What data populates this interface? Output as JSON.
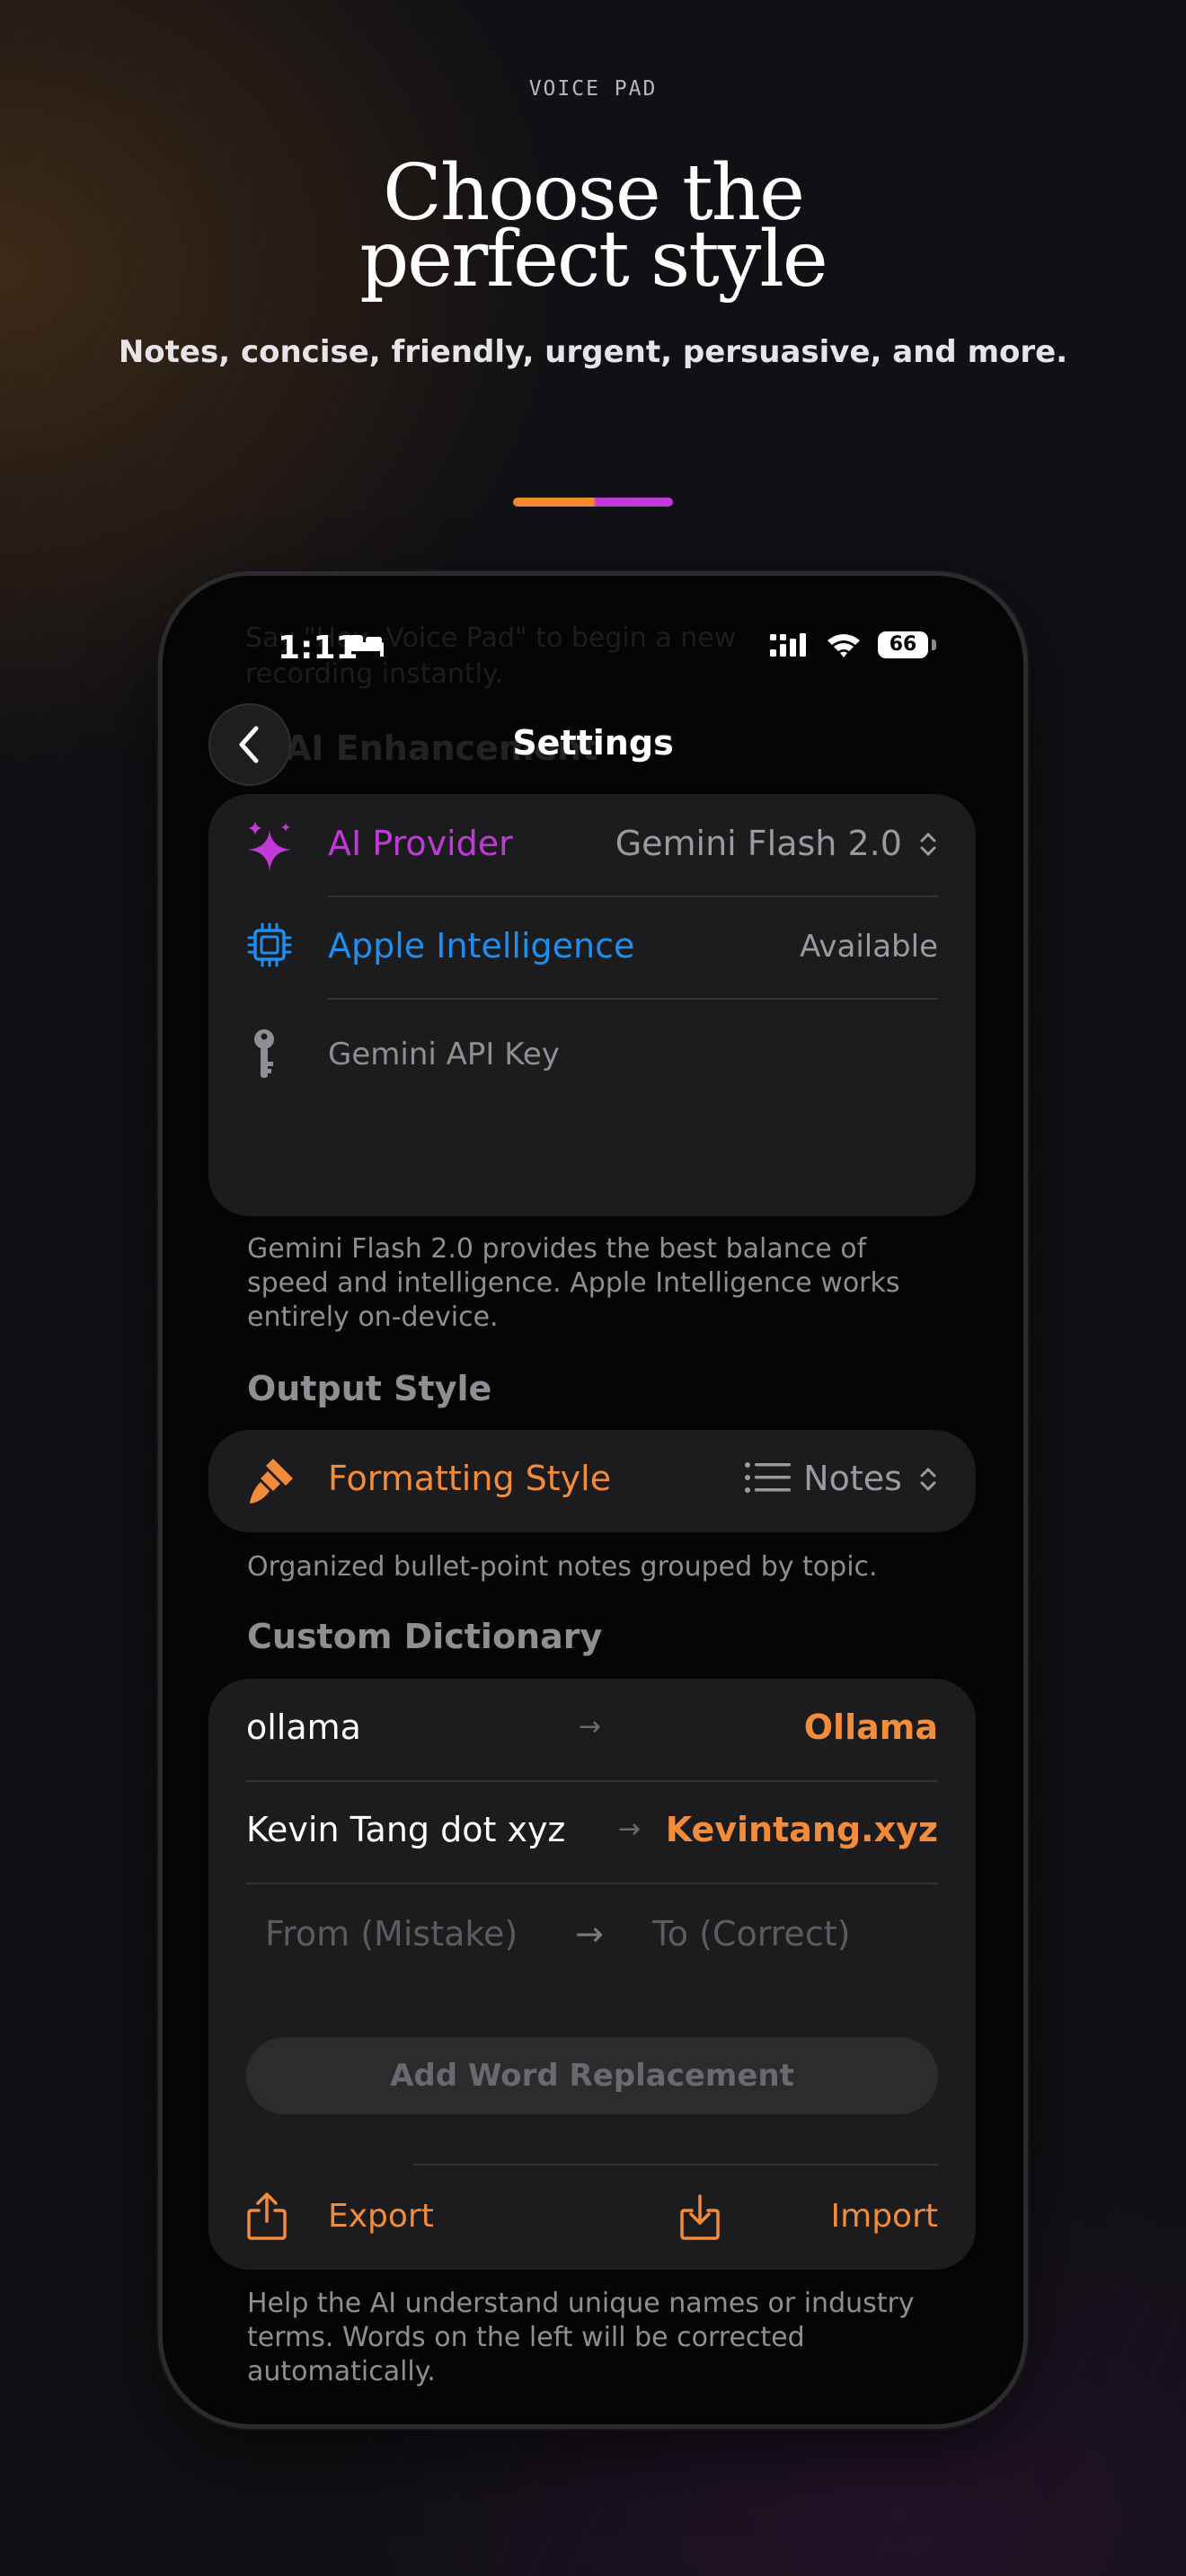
{
  "header": {
    "eyebrow": "VOICE PAD",
    "headline_line1": "Choose the",
    "headline_line2": "perfect style",
    "subhead": "Notes, concise, friendly, urgent, persuasive, and more."
  },
  "colors": {
    "accent_orange": "#f28c3a",
    "accent_purple": "#c13ad9",
    "accent_blue": "#1e8ef0",
    "card_bg": "#1c1c1e"
  },
  "status_bar": {
    "time": "1:11",
    "battery": "66",
    "icons": [
      "bed-icon",
      "signal-icon",
      "wifi-icon",
      "battery-icon"
    ]
  },
  "ghost_text": {
    "line1": "Say \"Hey, Voice Pad\" to begin a new",
    "line2": "recording instantly.",
    "section": "AI Enhancement"
  },
  "nav": {
    "title": "Settings",
    "back_icon": "chevron-left-icon"
  },
  "ai_section": {
    "rows": [
      {
        "icon": "sparkles-icon",
        "label": "AI Provider",
        "value": "Gemini Flash 2.0",
        "color": "#c13ad9"
      },
      {
        "icon": "cpu-icon",
        "label": "Apple Intelligence",
        "value": "Available",
        "color": "#1e8ef0"
      },
      {
        "icon": "key-icon",
        "label": "Gemini API Key",
        "value": ""
      }
    ],
    "footnote": "Gemini Flash 2.0 provides the best balance of speed and intelligence. Apple Intelligence works entirely on-device."
  },
  "output_style": {
    "section_title": "Output Style",
    "label": "Formatting Style",
    "value": "Notes",
    "icon": "paintbrush-icon",
    "footnote": "Organized bullet-point notes grouped by topic."
  },
  "dictionary": {
    "section_title": "Custom Dictionary",
    "entries": [
      {
        "from": "ollama",
        "to": "Ollama"
      },
      {
        "from": "Kevin Tang dot xyz",
        "to": "Kevintang.xyz"
      }
    ],
    "from_placeholder": "From (Mistake)",
    "to_placeholder": "To (Correct)",
    "add_button": "Add Word Replacement",
    "export_label": "Export",
    "import_label": "Import",
    "footnote": "Help the AI understand unique names or industry terms. Words on the left will be corrected automatically."
  }
}
